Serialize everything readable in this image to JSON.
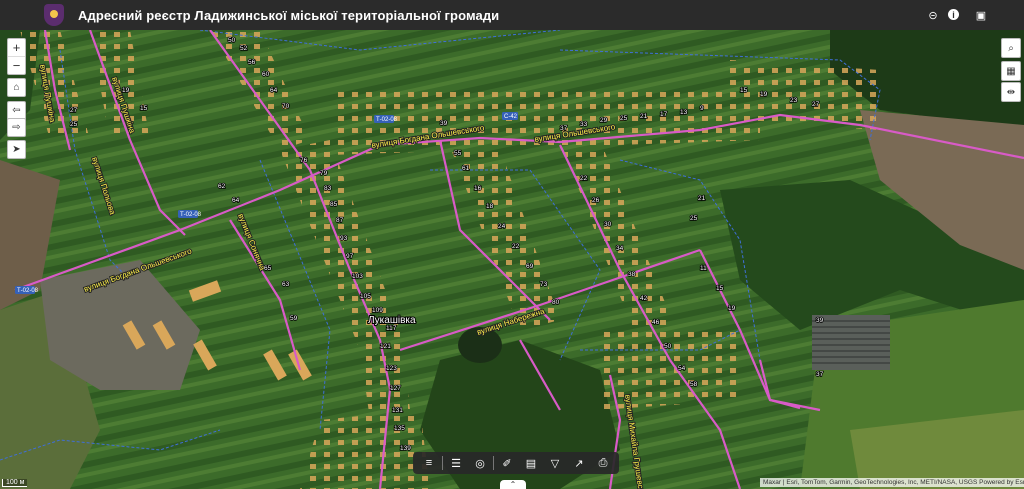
{
  "header": {
    "title": "Адресний реєстр Ладижинської міської територіальної громади",
    "icons": [
      "crest-logo",
      "hide-icon",
      "info-icon",
      "save-icon"
    ]
  },
  "map": {
    "place_name": "Лукашівка",
    "road_labels": [
      "вулиця Богдана Ольшевського",
      "вулиця Богдана Ольшевського",
      "вулиця Ольшевського",
      "вулиця Набережна",
      "вулиця Михайла Грушевського",
      "вулиця Пушкіна",
      "вулиця Пушкіна",
      "вулиця Польова",
      "вулиця Сонячна"
    ],
    "shields": [
      "Т-02-08",
      "Т-02-08",
      "Т-02-08",
      "С-42"
    ],
    "scale_label": "100 м",
    "attribution": "Maxar | Esri, TomTom, Garmin, GeoTechnologies, Inc, METI/NASA, USGS    Powered by Esri"
  },
  "controls": {
    "zoom_in": "+",
    "zoom_out": "−"
  },
  "colors": {
    "road": "#d85bc7",
    "road_label": "#fff24a",
    "parcel_border": "#3f6fd9",
    "header_bg": "#2b2b2b"
  }
}
